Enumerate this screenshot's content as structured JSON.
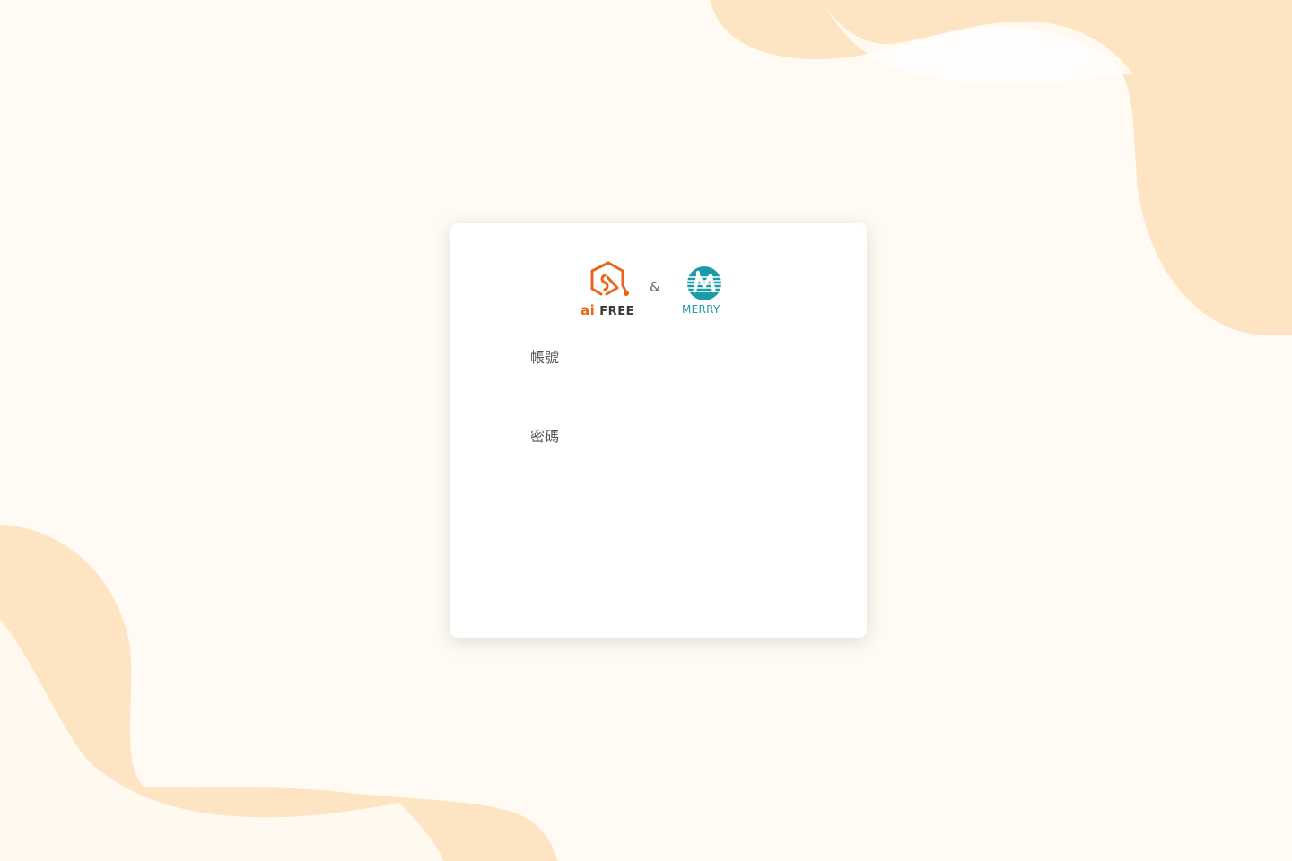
{
  "colors": {
    "background": "#fffaf3",
    "blob": "#fde5c3",
    "card": "#ffffff",
    "aifree_orange": "#e8651a",
    "merry_teal": "#1c9aa6"
  },
  "logos": {
    "aifree": {
      "icon": "aifree-hexagon-icon",
      "prefix": "ai",
      "name": "FREE"
    },
    "separator": "&",
    "merry": {
      "icon": "merry-circle-icon",
      "name": "MERRY"
    }
  },
  "form": {
    "account_label": "帳號",
    "account_value": "",
    "password_label": "密碼",
    "password_value": ""
  }
}
